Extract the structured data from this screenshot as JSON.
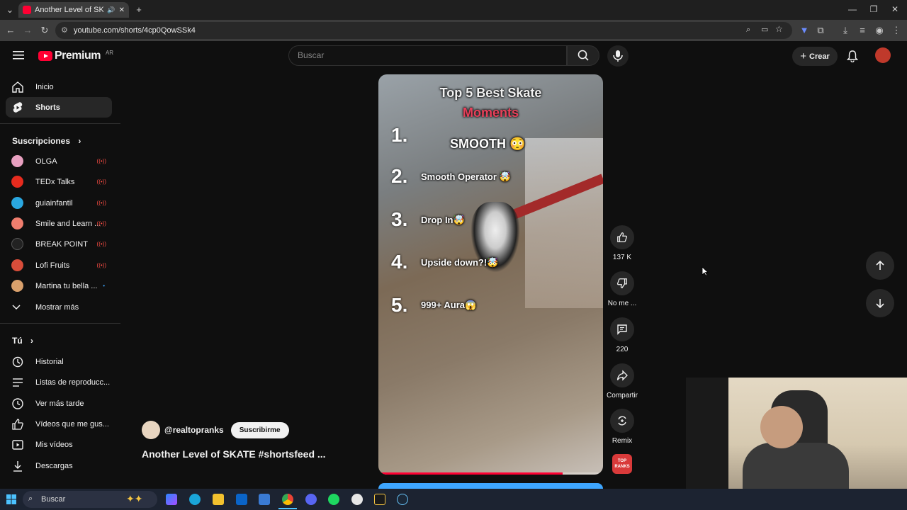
{
  "browser": {
    "tab_title": "Another Level of SKATE #sh",
    "url": "youtube.com/shorts/4cp0QowSSk4"
  },
  "masthead": {
    "logo_text": "Premium",
    "region": "AR",
    "search_placeholder": "Buscar",
    "create_label": "Crear"
  },
  "sidebar": {
    "main": [
      {
        "label": "Inicio",
        "icon": "home-icon"
      },
      {
        "label": "Shorts",
        "icon": "shorts-icon",
        "active": true
      }
    ],
    "subscriptions_header": "Suscripciones",
    "subscriptions": [
      {
        "label": "OLGA",
        "color": "#e8a0c0",
        "live": true
      },
      {
        "label": "TEDx Talks",
        "color": "#e62b1e",
        "live": true
      },
      {
        "label": "guiainfantil",
        "color": "#2aa7e0",
        "live": true
      },
      {
        "label": "Smile and Learn ...",
        "color": "#f07e6e",
        "live": true
      },
      {
        "label": "BREAK POINT",
        "color": "#222222",
        "live": true
      },
      {
        "label": "Lofi Fruits",
        "color": "#d84d3a",
        "live": true
      },
      {
        "label": "Martina tu bella ...",
        "color": "#d9a06c",
        "dot": true
      }
    ],
    "show_more": "Mostrar más",
    "you_header": "Tú",
    "you_items": [
      {
        "label": "Historial",
        "icon": "history-icon"
      },
      {
        "label": "Listas de reproducc...",
        "icon": "playlist-icon"
      },
      {
        "label": "Ver más tarde",
        "icon": "clock-icon"
      },
      {
        "label": "Vídeos que me gus...",
        "icon": "thumb-up-icon"
      },
      {
        "label": "Mis vídeos",
        "icon": "my-videos-icon"
      },
      {
        "label": "Descargas",
        "icon": "download-icon"
      }
    ]
  },
  "short": {
    "overlay_title_1": "Top 5 Best Skate",
    "overlay_title_2": "Moments",
    "ranks": [
      {
        "num": "1.",
        "label": "SMOOTH 😳"
      },
      {
        "num": "2.",
        "label": "Smooth Operator 🤯"
      },
      {
        "num": "3.",
        "label": "Drop In🤯"
      },
      {
        "num": "4.",
        "label": "Upside down?!🤯"
      },
      {
        "num": "5.",
        "label": "999+ Aura😱"
      }
    ],
    "progress": 0.82,
    "channel": "@realtopranks",
    "subscribe_label": "Suscribirme",
    "title": "Another Level of SKATE #shortsfeed ...",
    "actions": {
      "likes": "137 K",
      "dislike": "No me ...",
      "comments": "220",
      "share": "Compartir",
      "remix": "Remix"
    },
    "channel_badge": "TOP RANKS"
  },
  "taskbar": {
    "search_placeholder": "Buscar"
  }
}
